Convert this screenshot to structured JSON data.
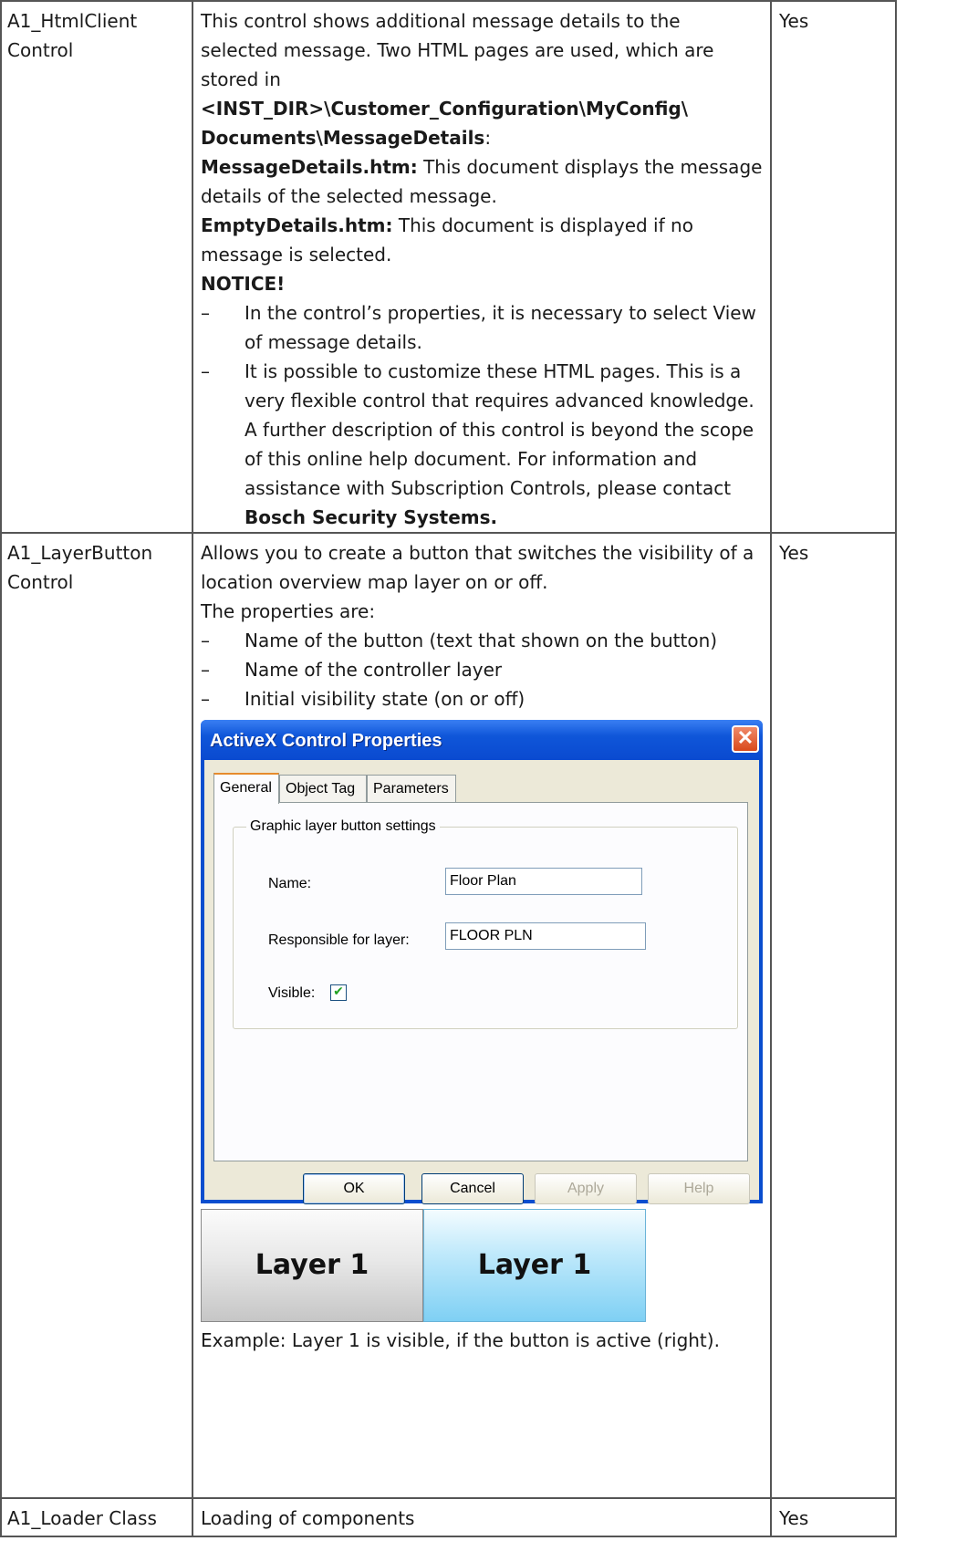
{
  "rows": [
    {
      "name_line1": "A1_HtmlClient",
      "name_line2": "Control",
      "status": "Yes",
      "intro": "This control shows additional message details to the selected message. Two HTML pages are used, which are stored in ",
      "path": "<INST_DIR>\\Customer_Configuration\\MyConfig\\ Documents\\MessageDetails",
      "path_suffix": ":",
      "item1_label": "MessageDetails.htm:",
      "item1_text": " This document displays the message details of the selected message.",
      "item2_label": "EmptyDetails.htm:",
      "item2_text": " This document is displayed if no message is selected.",
      "notice": "NOTICE!",
      "bullet1": "In the control’s properties, it is necessary to select View of message details.",
      "bullet2": "It is possible to customize these HTML pages. This is a very flexible control that requires advanced knowledge. A further description of this control is beyond the scope of this online help document. For information and assistance with Subscription Controls, please contact ",
      "bullet2_bold": "Bosch Security Systems.",
      "dash": "–"
    },
    {
      "name_line1": "A1_LayerButton",
      "name_line2": "Control",
      "status": "Yes",
      "intro": "Allows you to create a button that switches the visibility of a location overview map layer on or off.",
      "props_heading": "The properties are:",
      "bullets": [
        "Name of the button (text that shown on the button)",
        "Name of the controller layer",
        "Initial visibility state (on or off)"
      ],
      "caption": "Example: Layer 1 is visible, if the button is active (right)."
    },
    {
      "name_line1": "A1_Loader Class",
      "desc": "Loading of components",
      "status": "Yes"
    }
  ],
  "dialog": {
    "title": "ActiveX Control Properties",
    "close_glyph": "✕",
    "tabs": [
      "General",
      "Object Tag",
      "Parameters"
    ],
    "active_tab": "General",
    "group_label": "Graphic layer button settings",
    "name_label": "Name:",
    "name_value": "Floor Plan",
    "layer_label": "Responsible for layer:",
    "layer_value": "FLOOR PLN",
    "visible_label": "Visible:",
    "visible_checked": true,
    "check_glyph": "✔",
    "buttons": [
      "OK",
      "Cancel",
      "Apply",
      "Help"
    ]
  },
  "layer_examples": {
    "inactive_label": "Layer 1",
    "active_label": "Layer 1"
  },
  "colors": {
    "title_bar": "#0a4ecf",
    "dialog_face": "#ece9d8",
    "active_layer": "#7fd0f4"
  }
}
